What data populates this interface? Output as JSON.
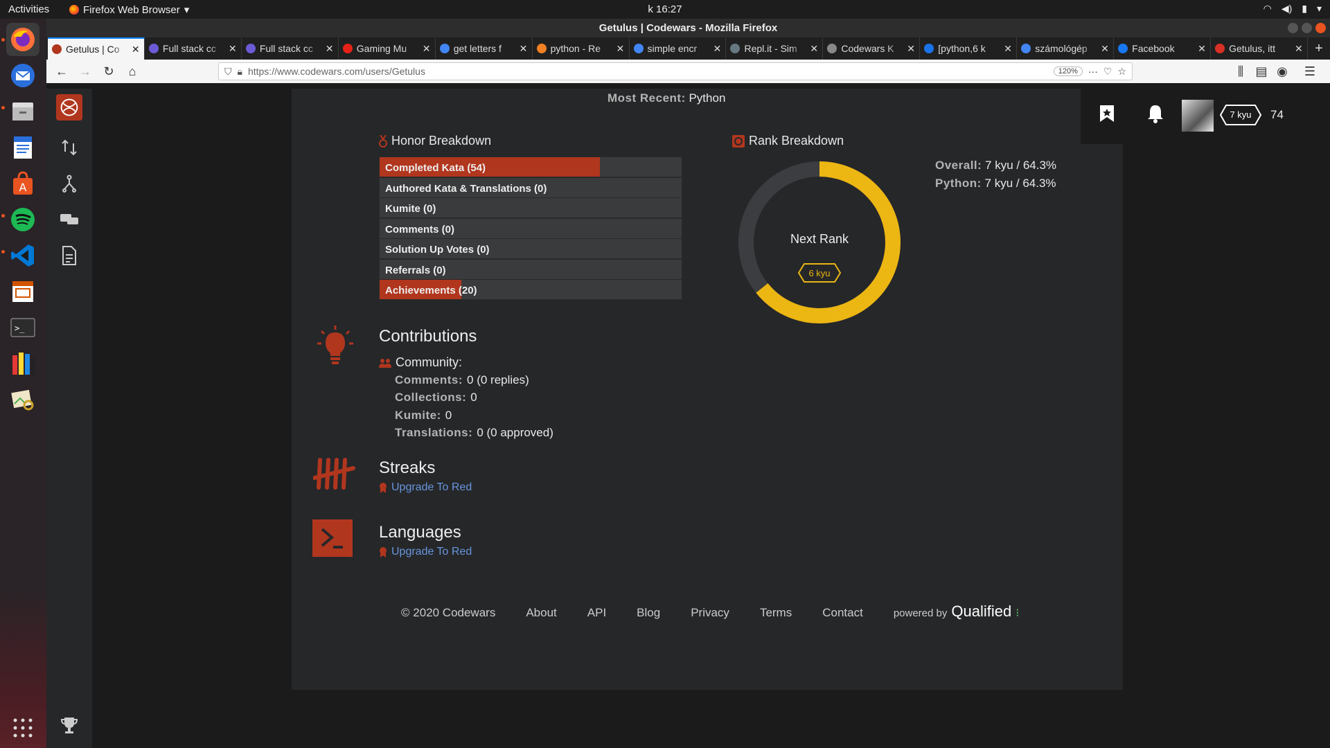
{
  "system": {
    "activities": "Activities",
    "app_menu": "Firefox Web Browser",
    "clock": "k 16:27"
  },
  "window": {
    "title": "Getulus | Codewars - Mozilla Firefox"
  },
  "tabs": [
    {
      "label": "Getulus | Co",
      "color": "#b1361e"
    },
    {
      "label": "Full stack cc",
      "color": "#6b5bd6"
    },
    {
      "label": "Full stack cc",
      "color": "#6b5bd6"
    },
    {
      "label": "Gaming Mu",
      "color": "#e62117"
    },
    {
      "label": "get letters f",
      "color": "#4285f4"
    },
    {
      "label": "python - Re",
      "color": "#f48024"
    },
    {
      "label": "simple encr",
      "color": "#4285f4"
    },
    {
      "label": "Repl.it - Sim",
      "color": "#667881"
    },
    {
      "label": "Codewars K",
      "color": "#888888"
    },
    {
      "label": "[python,6 k",
      "color": "#1a73e8"
    },
    {
      "label": "számológép",
      "color": "#4285f4"
    },
    {
      "label": "Facebook",
      "color": "#1877f2"
    },
    {
      "label": "Getulus, itt",
      "color": "#d93025"
    }
  ],
  "navbar": {
    "url": "https://www.codewars.com/users/Getulus",
    "zoom": "120%"
  },
  "header": {
    "rank_badge": "7 kyu",
    "honor": "74"
  },
  "profile": {
    "most_recent_label": "Most Recent:",
    "most_recent_value": "Python"
  },
  "honor_breakdown": {
    "title": "Honor Breakdown",
    "items": [
      {
        "label": "Completed Kata (54)",
        "fraction": 0.73
      },
      {
        "label": "Authored Kata & Translations (0)",
        "fraction": 0
      },
      {
        "label": "Kumite (0)",
        "fraction": 0
      },
      {
        "label": "Comments (0)",
        "fraction": 0
      },
      {
        "label": "Solution Up Votes (0)",
        "fraction": 0
      },
      {
        "label": "Referrals (0)",
        "fraction": 0
      },
      {
        "label": "Achievements (20)",
        "fraction": 0.27
      }
    ]
  },
  "rank_breakdown": {
    "title": "Rank Breakdown",
    "progress_percent": 64.3,
    "next_rank_label": "Next Rank",
    "next_rank_badge": "6 kyu",
    "overall_label": "Overall:",
    "overall_value": "7 kyu / 64.3%",
    "python_label": "Python:",
    "python_value": "7 kyu / 64.3%",
    "ring_color": "#ecb613"
  },
  "contributions": {
    "title": "Contributions",
    "community_label": "Community:",
    "rows": [
      {
        "label": "Comments:",
        "value": "0 (0 replies)"
      },
      {
        "label": "Collections:",
        "value": "0"
      },
      {
        "label": "Kumite:",
        "value": "0"
      },
      {
        "label": "Translations:",
        "value": "0 (0 approved)"
      }
    ]
  },
  "streaks": {
    "title": "Streaks",
    "link": "Upgrade To Red"
  },
  "languages": {
    "title": "Languages",
    "link": "Upgrade To Red"
  },
  "footer": {
    "copyright": "© 2020 Codewars",
    "links": [
      "About",
      "API",
      "Blog",
      "Privacy",
      "Terms",
      "Contact"
    ],
    "powered_by": "powered by",
    "brand": "Qualified"
  },
  "colors": {
    "accent": "#b1361e",
    "link": "#6795de"
  }
}
